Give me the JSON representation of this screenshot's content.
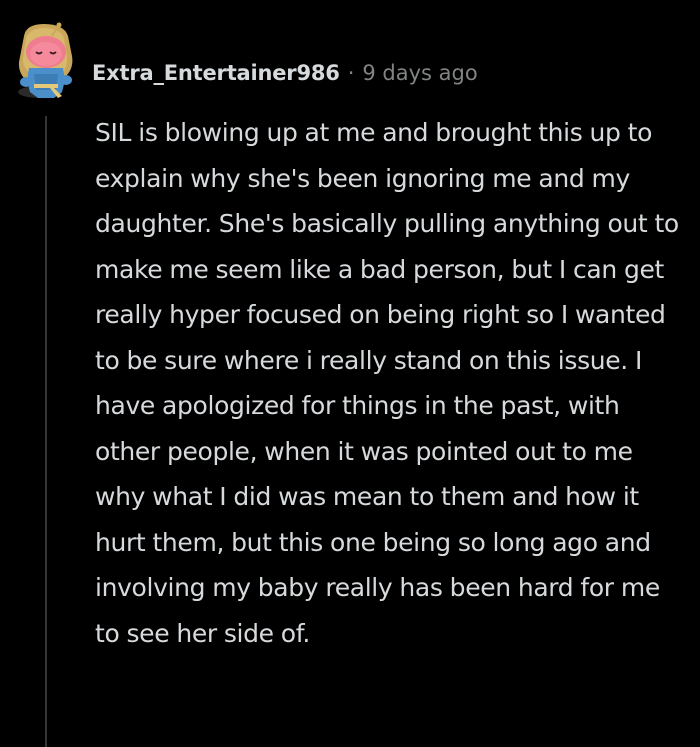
{
  "comment": {
    "author": "Extra_Entertainer986",
    "separator": "·",
    "timestamp": "9 days ago",
    "body": "SIL is blowing up at me and brought this up to explain why she's been ignoring me and my daughter. She's basically pulling anything out to make me seem like a bad person, but I can get really hyper focused on being right so I wanted to be sure where i really stand on this issue. I have apologized for things in the past, with other people, when it was pointed out to me why what I did was mean to them and how it hurt them, but this one being so long ago and involving my baby really has been hard for me to see her side of.",
    "avatar_icon": "snoo-avatar-icon"
  },
  "colors": {
    "background": "#000000",
    "text": "#d7dadc",
    "meta": "#818384",
    "thread_line": "#343536"
  }
}
